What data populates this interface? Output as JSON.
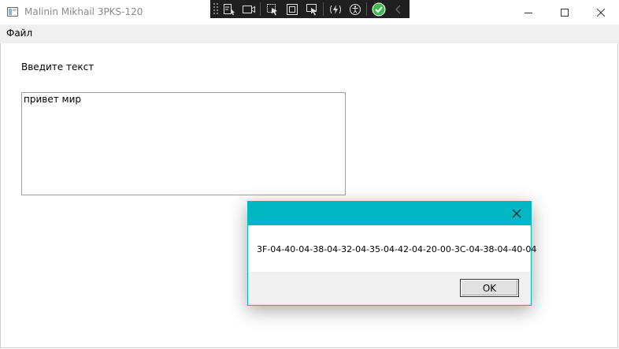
{
  "window": {
    "title": "Malinin Mikhail 3PKS-120"
  },
  "devtools_toolbar": {
    "icons": [
      "live-visual-tree-icon",
      "video-record-icon",
      "select-element-icon",
      "layout-adorner-icon",
      "track-focus-icon",
      "hot-reload-icon",
      "accessibility-icon",
      "binding-check-icon",
      "collapse-chevron-icon"
    ],
    "check_color": "#3fb950"
  },
  "menu": {
    "file_label": "Файл"
  },
  "main": {
    "prompt_label": "Введите текст",
    "input_value": "привет мир"
  },
  "dialog": {
    "message": "3F-04-40-04-38-04-32-04-35-04-42-04-20-00-3C-04-38-04-40-04",
    "ok_label": "OK",
    "accent_color": "#00b7c3"
  }
}
